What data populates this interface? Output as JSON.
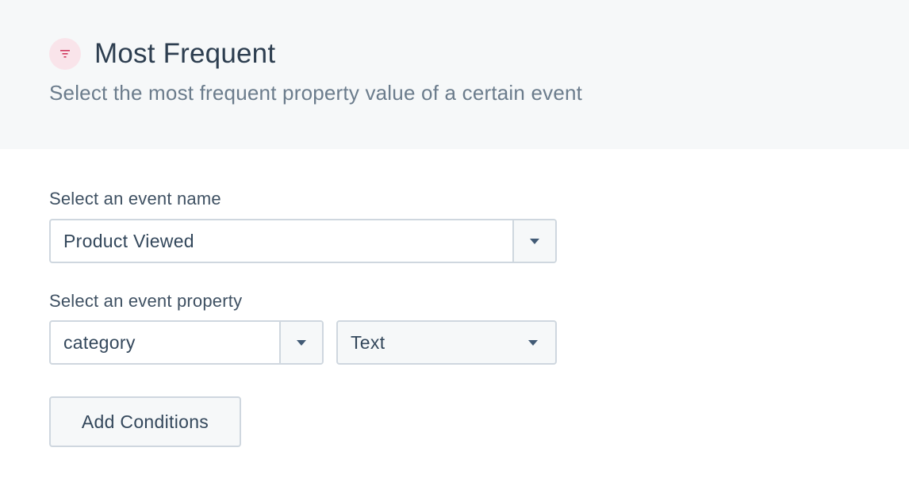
{
  "header": {
    "icon": "filter-icon",
    "title": "Most Frequent",
    "subtitle": "Select the most frequent property value of a certain event",
    "colors": {
      "background": "#f6f8f9",
      "icon_background": "#f9e4ea",
      "icon_color": "#d0395e"
    }
  },
  "event_name": {
    "label": "Select an event name",
    "value": "Product Viewed"
  },
  "event_property": {
    "label": "Select an event property",
    "property_value": "category",
    "type_value": "Text"
  },
  "actions": {
    "add_conditions_label": "Add Conditions"
  }
}
